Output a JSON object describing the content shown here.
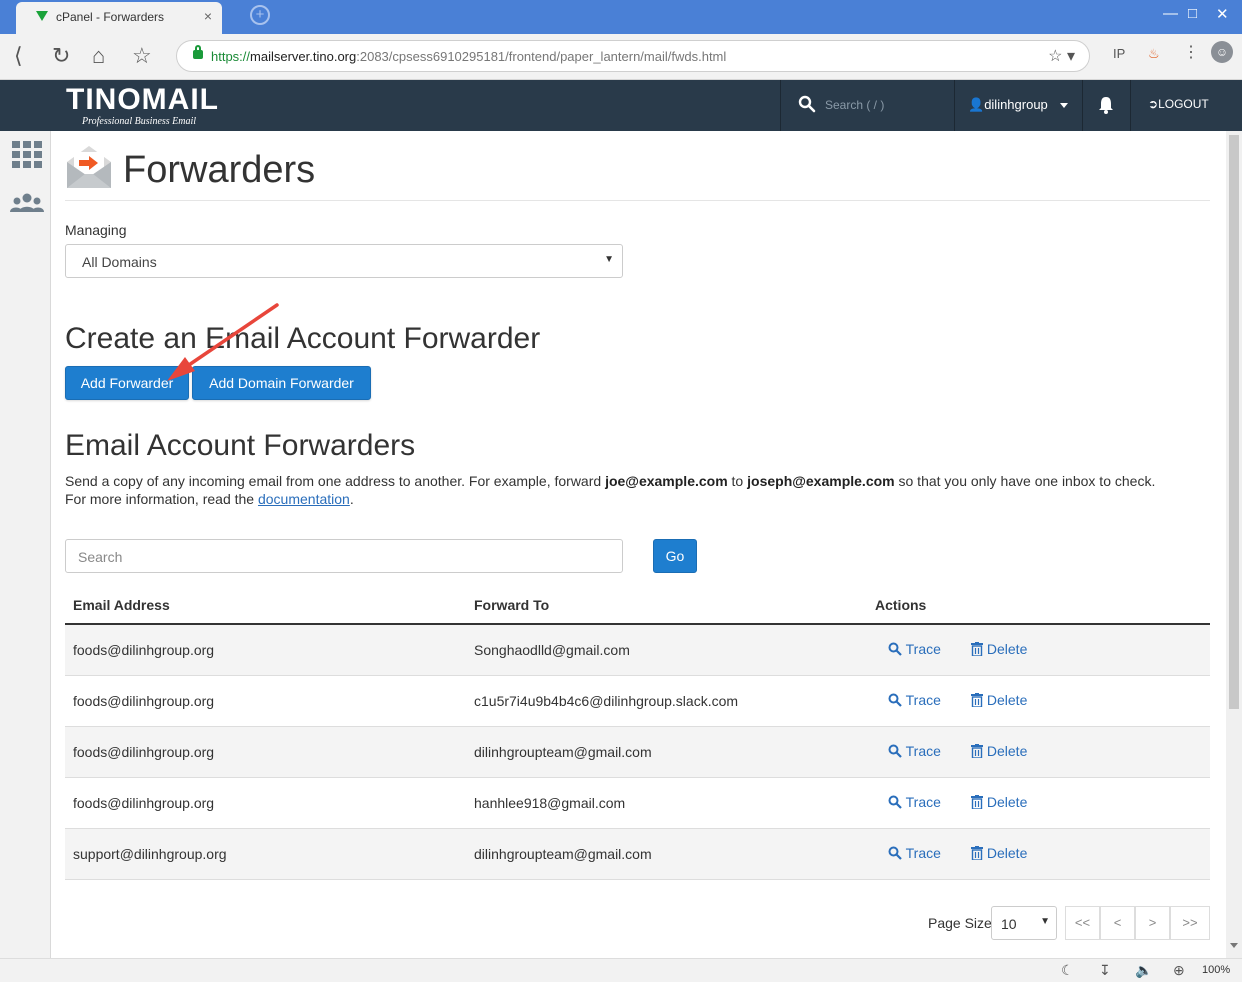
{
  "browser": {
    "tab_title": "cPanel - Forwarders",
    "tab_close": "×",
    "new_tab": "+",
    "url_secure": "https://",
    "url_host": "mailserver.tino.org",
    "url_rest": ":2083/cpsess6910295181/frontend/paper_lantern/mail/fwds.html",
    "zoom": "100%"
  },
  "header": {
    "logo": "TINOMAIL",
    "logo_tagline": "Professional Business Email",
    "search_placeholder": "Search ( / )",
    "username": "dilinhgroup",
    "logout": "LOGOUT"
  },
  "page": {
    "title": "Forwarders",
    "managing_label": "Managing",
    "managing_value": "All Domains"
  },
  "create_section": {
    "heading": "Create an Email Account Forwarder",
    "add_forwarder": "Add Forwarder",
    "add_domain_forwarder": "Add Domain Forwarder"
  },
  "list_section": {
    "heading": "Email Account Forwarders",
    "desc_1": "Send a copy of any incoming email from one address to another. For example, forward ",
    "desc_email1": "joe@example.com",
    "desc_2": " to ",
    "desc_email2": "joseph@example.com",
    "desc_3": " so that you only have one inbox to check.",
    "desc_4": "For more information, read the ",
    "desc_link": "documentation",
    "desc_5": ".",
    "search_placeholder": "Search",
    "go": "Go"
  },
  "table": {
    "columns": [
      "Email Address",
      "Forward To",
      "Actions"
    ],
    "trace_label": "Trace",
    "delete_label": "Delete",
    "rows": [
      {
        "email": "foods@dilinhgroup.org",
        "forward": "Songhaodlld@gmail.com"
      },
      {
        "email": "foods@dilinhgroup.org",
        "forward": "c1u5r7i4u9b4b4c6@dilinhgroup.slack.com"
      },
      {
        "email": "foods@dilinhgroup.org",
        "forward": "dilinhgroupteam@gmail.com"
      },
      {
        "email": "foods@dilinhgroup.org",
        "forward": "hanhlee918@gmail.com"
      },
      {
        "email": "support@dilinhgroup.org",
        "forward": "dilinhgroupteam@gmail.com"
      }
    ]
  },
  "pagination": {
    "page_size_label": "Page Size",
    "page_size": "10",
    "first": "<<",
    "prev": "<",
    "next": ">",
    "last": ">>"
  },
  "colors": {
    "header_bg": "#293a4a",
    "primary_button": "#1e7ecf",
    "link": "#2a6ebb",
    "annotation_arrow": "#e8463b"
  }
}
